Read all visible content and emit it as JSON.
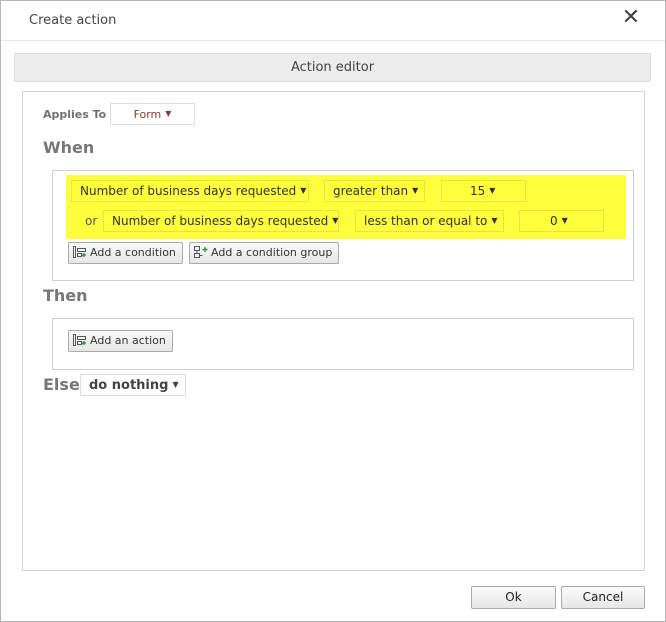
{
  "dialog": {
    "title": "Create action",
    "close_glyph": "✕"
  },
  "editor": {
    "header": "Action editor"
  },
  "applies_to": {
    "label": "Applies To",
    "value": "Form"
  },
  "sections": {
    "when": "When",
    "then": "Then",
    "else": "Else"
  },
  "conditions": [
    {
      "connector": "",
      "field": "Number of business days requested",
      "operator": "greater than",
      "value": "15"
    },
    {
      "connector": "or",
      "field": "Number of business days requested",
      "operator": "less than or equal to",
      "value": "0"
    }
  ],
  "buttons": {
    "add_condition": "Add a condition",
    "add_condition_group": "Add a condition group",
    "add_action": "Add an action",
    "ok": "Ok",
    "cancel": "Cancel"
  },
  "else_action": "do nothing",
  "colors": {
    "highlight": "#ffff3c",
    "header_bg": "#ececec"
  }
}
